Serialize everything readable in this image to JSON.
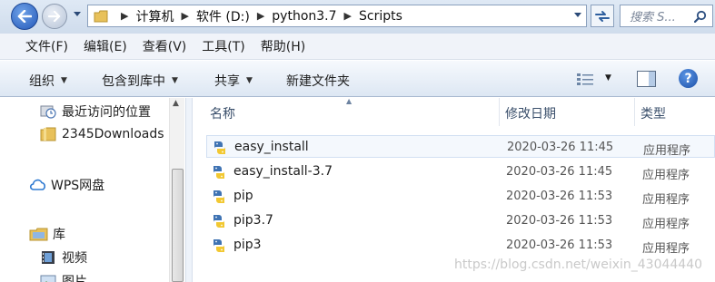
{
  "address": {
    "crumbs": [
      "计算机",
      "软件 (D:)",
      "python3.7",
      "Scripts"
    ],
    "search_placeholder": "搜索 S..."
  },
  "menu": [
    "文件(F)",
    "编辑(E)",
    "查看(V)",
    "工具(T)",
    "帮助(H)"
  ],
  "toolbar": {
    "organize": "组织",
    "include_library": "包含到库中",
    "share": "共享",
    "new_folder": "新建文件夹"
  },
  "nav": {
    "recent": "最近访问的位置",
    "downloads": "2345Downloads",
    "wps": "WPS网盘",
    "library": "库",
    "videos": "视频",
    "pictures": "图片"
  },
  "columns": {
    "name": "名称",
    "modified": "修改日期",
    "type": "类型"
  },
  "files": [
    {
      "name": "easy_install",
      "modified": "2020-03-26 11:45",
      "type": "应用程序"
    },
    {
      "name": "easy_install-3.7",
      "modified": "2020-03-26 11:45",
      "type": "应用程序"
    },
    {
      "name": "pip",
      "modified": "2020-03-26 11:53",
      "type": "应用程序"
    },
    {
      "name": "pip3.7",
      "modified": "2020-03-26 11:53",
      "type": "应用程序"
    },
    {
      "name": "pip3",
      "modified": "2020-03-26 11:53",
      "type": "应用程序"
    }
  ],
  "watermark": "https://blog.csdn.net/weixin_43044440"
}
